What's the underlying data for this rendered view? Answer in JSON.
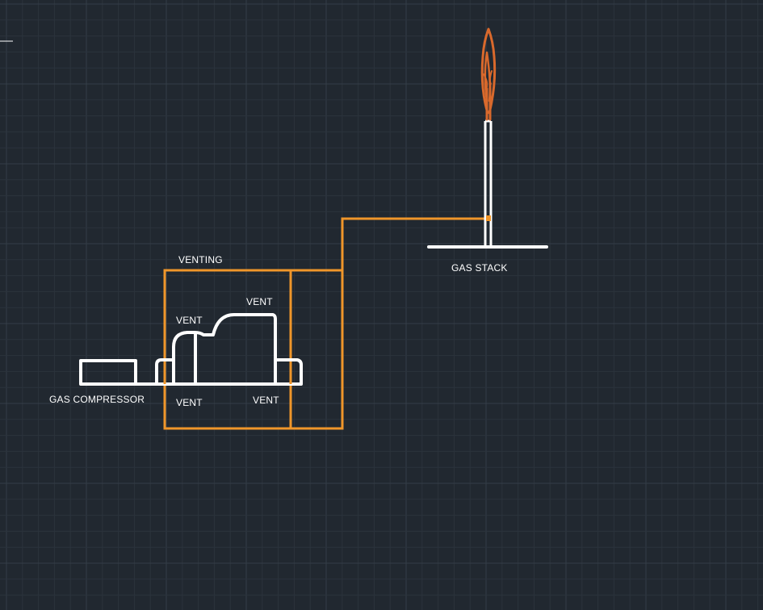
{
  "labels": {
    "venting": "VENTING",
    "vent_top_left": "VENT",
    "vent_top_right": "VENT",
    "vent_bottom_left": "VENT",
    "vent_bottom_right": "VENT",
    "gas_compressor": "GAS COMPRESSOR",
    "gas_stack": "GAS STACK"
  },
  "colors": {
    "background": "#212830",
    "grid_minor": "#2b333c",
    "grid_major": "#343d47",
    "equipment": "#ffffff",
    "piping": "#f0962a",
    "flame": "#d9692c"
  }
}
